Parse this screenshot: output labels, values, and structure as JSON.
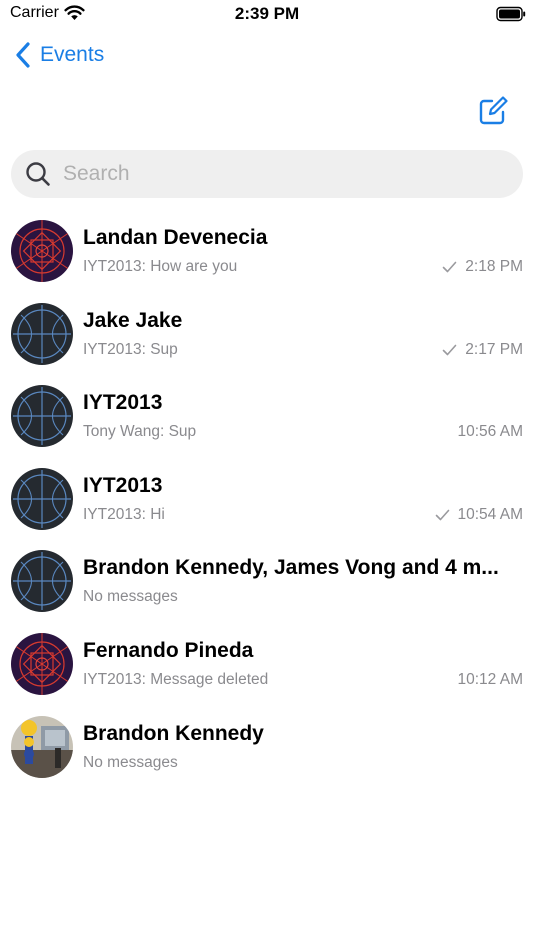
{
  "status_bar": {
    "carrier": "Carrier",
    "time": "2:39 PM"
  },
  "nav": {
    "back_label": "Events",
    "accent_color": "#1a7ee5"
  },
  "search": {
    "placeholder": "Search",
    "value": ""
  },
  "conversations": [
    {
      "title": "Landan Devenecia",
      "subtitle": "IYT2013: How are you",
      "time": "2:18 PM",
      "read_check": true,
      "avatar": "purple-pattern"
    },
    {
      "title": "Jake Jake",
      "subtitle": "IYT2013: Sup",
      "time": "2:17 PM",
      "read_check": true,
      "avatar": "dark-circle-pattern"
    },
    {
      "title": "IYT2013",
      "subtitle": "Tony Wang: Sup",
      "time": "10:56 AM",
      "read_check": false,
      "avatar": "dark-circle-pattern"
    },
    {
      "title": "IYT2013",
      "subtitle": "IYT2013: Hi",
      "time": "10:54 AM",
      "read_check": true,
      "avatar": "dark-circle-pattern"
    },
    {
      "title": "Brandon Kennedy, James Vong and 4 m...",
      "subtitle": "No messages",
      "time": "",
      "read_check": false,
      "avatar": "dark-circle-pattern"
    },
    {
      "title": "Fernando Pineda",
      "subtitle": "IYT2013: Message deleted",
      "time": "10:12 AM",
      "read_check": false,
      "avatar": "purple-pattern"
    },
    {
      "title": "Brandon Kennedy",
      "subtitle": "No messages",
      "time": "",
      "read_check": false,
      "avatar": "photo"
    }
  ]
}
